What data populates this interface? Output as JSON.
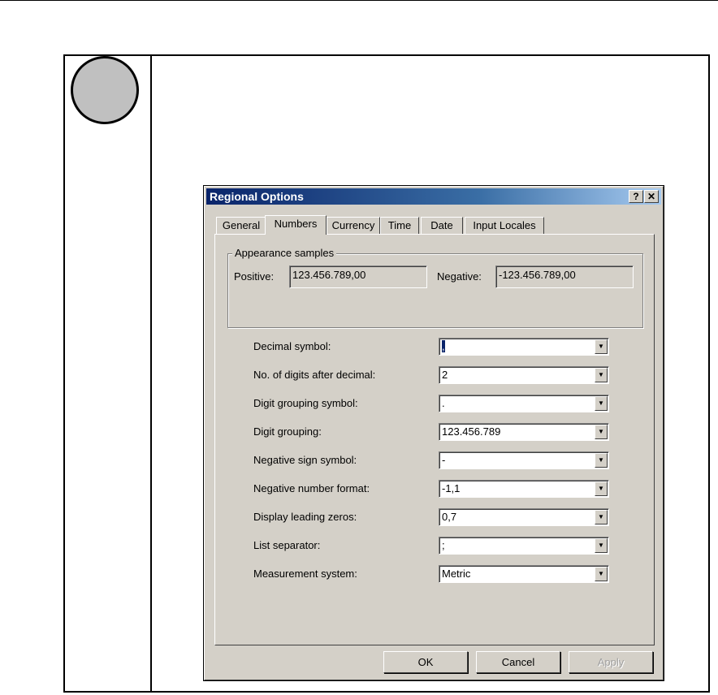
{
  "dialog": {
    "title": "Regional Options",
    "help_glyph": "?",
    "close_glyph": "✕",
    "tabs": [
      {
        "label": "General"
      },
      {
        "label": "Numbers",
        "active": true
      },
      {
        "label": "Currency"
      },
      {
        "label": "Time"
      },
      {
        "label": "Date"
      },
      {
        "label": "Input Locales"
      }
    ],
    "samples": {
      "group_label": "Appearance samples",
      "positive_label": "Positive:",
      "positive_value": "123.456.789,00",
      "negative_label": "Negative:",
      "negative_value": "-123.456.789,00"
    },
    "settings": [
      {
        "label": "Decimal symbol:",
        "value": ","
      },
      {
        "label": "No. of digits after decimal:",
        "value": "2"
      },
      {
        "label": "Digit grouping symbol:",
        "value": "."
      },
      {
        "label": "Digit grouping:",
        "value": "123.456.789"
      },
      {
        "label": "Negative sign symbol:",
        "value": "-"
      },
      {
        "label": "Negative number format:",
        "value": "-1,1"
      },
      {
        "label": "Display leading zeros:",
        "value": "0,7"
      },
      {
        "label": "List separator:",
        "value": ";"
      },
      {
        "label": "Measurement system:",
        "value": "Metric"
      }
    ],
    "buttons": {
      "ok": "OK",
      "cancel": "Cancel",
      "apply": "Apply"
    },
    "icons": {
      "dropdown": "chevron-down-icon",
      "help": "help-icon",
      "close": "close-icon"
    }
  },
  "colors": {
    "titlebar_start": "#0a246a",
    "titlebar_end": "#a6caf0",
    "dialog_face": "#d4d0c8",
    "step_circle": "#c0c0c0"
  }
}
